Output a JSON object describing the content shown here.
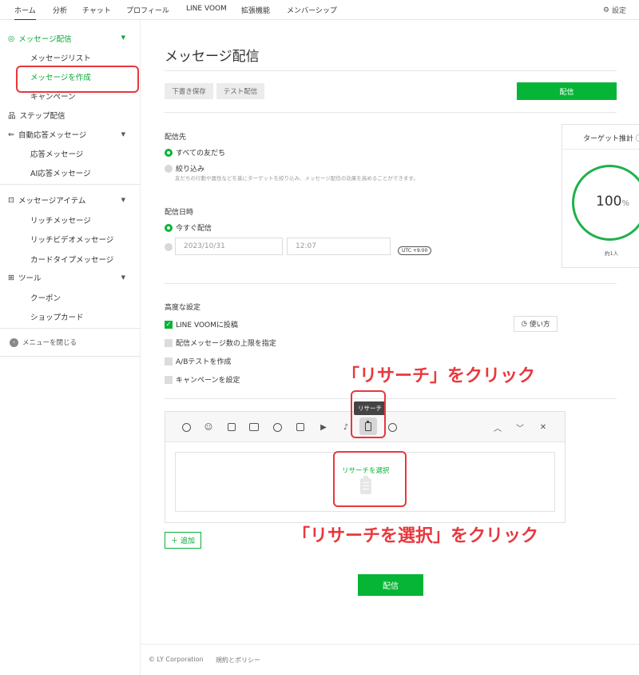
{
  "topnav": {
    "tabs": [
      "ホーム",
      "分析",
      "チャット",
      "プロフィール",
      "LINE VOOM",
      "拡張機能",
      "メンバーシップ"
    ],
    "settings_label": "設定"
  },
  "sidebar": {
    "message_delivery": "メッセージ配信",
    "message_list": "メッセージリスト",
    "create_message": "メッセージを作成",
    "campaign": "キャンペーン",
    "step_delivery": "ステップ配信",
    "auto_reply": "自動応答メッセージ",
    "reply_message": "応答メッセージ",
    "ai_reply": "AI応答メッセージ",
    "message_items": "メッセージアイテム",
    "rich_message": "リッチメッセージ",
    "rich_video": "リッチビデオメッセージ",
    "card_type": "カードタイプメッセージ",
    "tools": "ツール",
    "coupon": "クーポン",
    "shop_card": "ショップカード",
    "close_menu": "メニューを閉じる"
  },
  "main": {
    "title": "メッセージ配信",
    "save_draft": "下書き保存",
    "test_delivery": "テスト配信",
    "deliver": "配信",
    "recipients_label": "配信先",
    "all_friends": "すべての友だち",
    "filter": "絞り込み",
    "filter_hint": "友だちの行動や属性などを基にターゲットを絞り込み、メッセージ配信の効果を高めることができます。",
    "datetime_label": "配信日時",
    "send_now": "今すぐ配信",
    "date_value": "2023/10/31",
    "time_value": "12:07",
    "utc": "UTC +9:00",
    "advanced_label": "高度な設定",
    "post_voom": "LINE VOOMに投稿",
    "limit_messages": "配信メッセージ数の上限を指定",
    "ab_test": "A/Bテストを作成",
    "set_campaign": "キャンペーンを設定",
    "howto": "使い方",
    "add": "追加",
    "deliver_bottom": "配信"
  },
  "target": {
    "title": "ターゲット推計",
    "value": "100",
    "unit": "%",
    "approx": "約1人"
  },
  "editor": {
    "tooltip": "リサーチ",
    "select_research": "リサーチを選択"
  },
  "annotations": {
    "click_research": "「リサーチ」をクリック",
    "click_select": "「リサーチを選択」をクリック"
  },
  "footer": {
    "copyright": "© LY Corporation",
    "policy": "規約とポリシー"
  },
  "colors": {
    "brand_green": "#06b535",
    "annotation_red": "#e8383d"
  }
}
